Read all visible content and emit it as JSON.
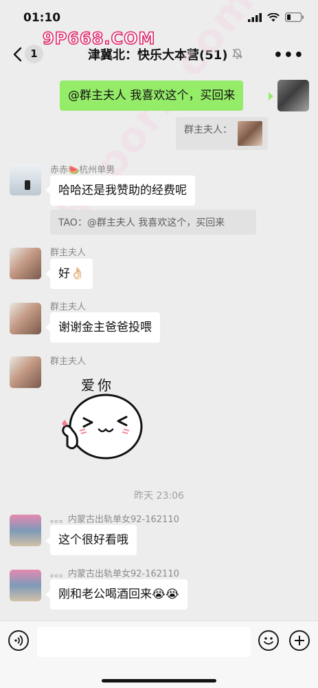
{
  "status": {
    "time": "01:10"
  },
  "watermark": {
    "top_text": "9P668.COM"
  },
  "nav": {
    "unread": "1",
    "title": "津冀北：快乐大本营(51)"
  },
  "messages": {
    "m1": {
      "text": "@群主夫人 我喜欢这个，买回来",
      "quote_label": "群主夫人："
    },
    "m2": {
      "sender": "赤赤🍉杭州单男",
      "text": "哈哈还是我赞助的经费呢",
      "quote": "TAO：@群主夫人 我喜欢这个，买回来"
    },
    "m3": {
      "sender": "群主夫人",
      "text": "好👌🏻"
    },
    "m4": {
      "sender": "群主夫人",
      "text": "谢谢金主爸爸投喂"
    },
    "m5": {
      "sender": "群主夫人",
      "sticker_text": "爱你"
    },
    "timestamp": "昨天 23:06",
    "m6": {
      "sender": "。。。内蒙古出轨单女92-162110",
      "text": "这个很好看哦"
    },
    "m7": {
      "sender": "。。。内蒙古出轨单女92-162110",
      "text": "刚和老公喝酒回来😭😭"
    }
  },
  "icons": {
    "back": "chevron-left-icon",
    "mute": "bell-off-icon",
    "more": "more-icon",
    "voice": "voice-icon",
    "emoji": "emoji-icon",
    "plus": "plus-icon"
  },
  "colors": {
    "bg": "#ededed",
    "out_bubble": "#95ec69",
    "in_bubble": "#ffffff",
    "watermark": "#e0246a"
  }
}
